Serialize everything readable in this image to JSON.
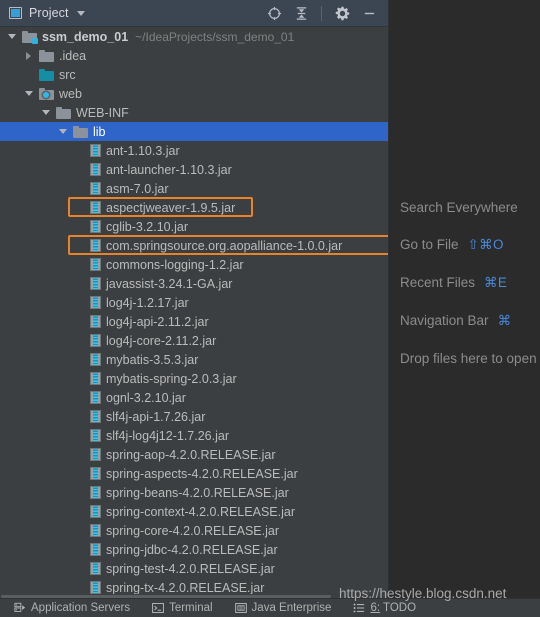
{
  "toolwindow": {
    "title": "Project",
    "icons": {
      "dropdown": "chevron-down-icon",
      "locate": "locate-icon",
      "collapse_all": "collapse-all-icon",
      "settings": "gear-icon",
      "hide": "minimize-icon"
    }
  },
  "tree": {
    "rows": [
      {
        "label": "ssm_demo_01",
        "path": "~/IdeaProjects/ssm_demo_01",
        "indent": 0,
        "arrow": "expanded",
        "icon": "module-folder",
        "bold": true,
        "selected": false,
        "highlight": false
      },
      {
        "label": ".idea",
        "path": "",
        "indent": 1,
        "arrow": "collapsed",
        "icon": "folder",
        "bold": false,
        "selected": false,
        "highlight": false
      },
      {
        "label": "src",
        "path": "",
        "indent": 1,
        "arrow": "none",
        "icon": "source-folder",
        "bold": false,
        "selected": false,
        "highlight": false
      },
      {
        "label": "web",
        "path": "",
        "indent": 1,
        "arrow": "expanded",
        "icon": "web-folder",
        "bold": false,
        "selected": false,
        "highlight": false
      },
      {
        "label": "WEB-INF",
        "path": "",
        "indent": 2,
        "arrow": "expanded",
        "icon": "folder",
        "bold": false,
        "selected": false,
        "highlight": false
      },
      {
        "label": "lib",
        "path": "",
        "indent": 3,
        "arrow": "expanded",
        "icon": "folder",
        "bold": false,
        "selected": true,
        "highlight": false
      },
      {
        "label": "ant-1.10.3.jar",
        "path": "",
        "indent": 4,
        "arrow": "none",
        "icon": "jar",
        "bold": false,
        "selected": false,
        "highlight": false
      },
      {
        "label": "ant-launcher-1.10.3.jar",
        "path": "",
        "indent": 4,
        "arrow": "none",
        "icon": "jar",
        "bold": false,
        "selected": false,
        "highlight": false
      },
      {
        "label": "asm-7.0.jar",
        "path": "",
        "indent": 4,
        "arrow": "none",
        "icon": "jar",
        "bold": false,
        "selected": false,
        "highlight": false
      },
      {
        "label": "aspectjweaver-1.9.5.jar",
        "path": "",
        "indent": 4,
        "arrow": "none",
        "icon": "jar",
        "bold": false,
        "selected": false,
        "highlight": true,
        "highlight_width": 185
      },
      {
        "label": "cglib-3.2.10.jar",
        "path": "",
        "indent": 4,
        "arrow": "none",
        "icon": "jar",
        "bold": false,
        "selected": false,
        "highlight": false
      },
      {
        "label": "com.springsource.org.aopalliance-1.0.0.jar",
        "path": "",
        "indent": 4,
        "arrow": "none",
        "icon": "jar",
        "bold": false,
        "selected": false,
        "highlight": true,
        "highlight_width": 328
      },
      {
        "label": "commons-logging-1.2.jar",
        "path": "",
        "indent": 4,
        "arrow": "none",
        "icon": "jar",
        "bold": false,
        "selected": false,
        "highlight": false
      },
      {
        "label": "javassist-3.24.1-GA.jar",
        "path": "",
        "indent": 4,
        "arrow": "none",
        "icon": "jar",
        "bold": false,
        "selected": false,
        "highlight": false
      },
      {
        "label": "log4j-1.2.17.jar",
        "path": "",
        "indent": 4,
        "arrow": "none",
        "icon": "jar",
        "bold": false,
        "selected": false,
        "highlight": false
      },
      {
        "label": "log4j-api-2.11.2.jar",
        "path": "",
        "indent": 4,
        "arrow": "none",
        "icon": "jar",
        "bold": false,
        "selected": false,
        "highlight": false
      },
      {
        "label": "log4j-core-2.11.2.jar",
        "path": "",
        "indent": 4,
        "arrow": "none",
        "icon": "jar",
        "bold": false,
        "selected": false,
        "highlight": false
      },
      {
        "label": "mybatis-3.5.3.jar",
        "path": "",
        "indent": 4,
        "arrow": "none",
        "icon": "jar",
        "bold": false,
        "selected": false,
        "highlight": false
      },
      {
        "label": "mybatis-spring-2.0.3.jar",
        "path": "",
        "indent": 4,
        "arrow": "none",
        "icon": "jar",
        "bold": false,
        "selected": false,
        "highlight": false
      },
      {
        "label": "ognl-3.2.10.jar",
        "path": "",
        "indent": 4,
        "arrow": "none",
        "icon": "jar",
        "bold": false,
        "selected": false,
        "highlight": false
      },
      {
        "label": "slf4j-api-1.7.26.jar",
        "path": "",
        "indent": 4,
        "arrow": "none",
        "icon": "jar",
        "bold": false,
        "selected": false,
        "highlight": false
      },
      {
        "label": "slf4j-log4j12-1.7.26.jar",
        "path": "",
        "indent": 4,
        "arrow": "none",
        "icon": "jar",
        "bold": false,
        "selected": false,
        "highlight": false
      },
      {
        "label": "spring-aop-4.2.0.RELEASE.jar",
        "path": "",
        "indent": 4,
        "arrow": "none",
        "icon": "jar",
        "bold": false,
        "selected": false,
        "highlight": false
      },
      {
        "label": "spring-aspects-4.2.0.RELEASE.jar",
        "path": "",
        "indent": 4,
        "arrow": "none",
        "icon": "jar",
        "bold": false,
        "selected": false,
        "highlight": false
      },
      {
        "label": "spring-beans-4.2.0.RELEASE.jar",
        "path": "",
        "indent": 4,
        "arrow": "none",
        "icon": "jar",
        "bold": false,
        "selected": false,
        "highlight": false
      },
      {
        "label": "spring-context-4.2.0.RELEASE.jar",
        "path": "",
        "indent": 4,
        "arrow": "none",
        "icon": "jar",
        "bold": false,
        "selected": false,
        "highlight": false
      },
      {
        "label": "spring-core-4.2.0.RELEASE.jar",
        "path": "",
        "indent": 4,
        "arrow": "none",
        "icon": "jar",
        "bold": false,
        "selected": false,
        "highlight": false
      },
      {
        "label": "spring-jdbc-4.2.0.RELEASE.jar",
        "path": "",
        "indent": 4,
        "arrow": "none",
        "icon": "jar",
        "bold": false,
        "selected": false,
        "highlight": false
      },
      {
        "label": "spring-test-4.2.0.RELEASE.jar",
        "path": "",
        "indent": 4,
        "arrow": "none",
        "icon": "jar",
        "bold": false,
        "selected": false,
        "highlight": false
      },
      {
        "label": "spring-tx-4.2.0.RELEASE.jar",
        "path": "",
        "indent": 4,
        "arrow": "none",
        "icon": "jar",
        "bold": false,
        "selected": false,
        "highlight": false
      }
    ]
  },
  "editor": {
    "hints": [
      {
        "text": "Search Everywhere",
        "keys": ""
      },
      {
        "text": "Go to File",
        "keys": "⇧⌘O"
      },
      {
        "text": "Recent Files",
        "keys": "⌘E"
      },
      {
        "text": "Navigation Bar",
        "keys": "⌘"
      },
      {
        "text": "Drop files here to open",
        "keys": ""
      }
    ]
  },
  "status_bar": {
    "items": [
      {
        "label": "Application Servers",
        "icon": "application-servers-icon"
      },
      {
        "label": "Terminal",
        "icon": "terminal-icon"
      },
      {
        "label": "Java Enterprise",
        "icon": "java-enterprise-icon"
      },
      {
        "label": "6: TODO",
        "icon": "todo-icon"
      }
    ]
  },
  "watermark": {
    "text": "https://hestyle.blog.csdn.net"
  },
  "colors": {
    "selection": "#2f65c9",
    "highlight": "#e8832a",
    "panel_bg": "#3c3f41",
    "editor_bg": "#2b2b2b",
    "header_bg": "#3c4552",
    "shortcut": "#4a88d8"
  }
}
